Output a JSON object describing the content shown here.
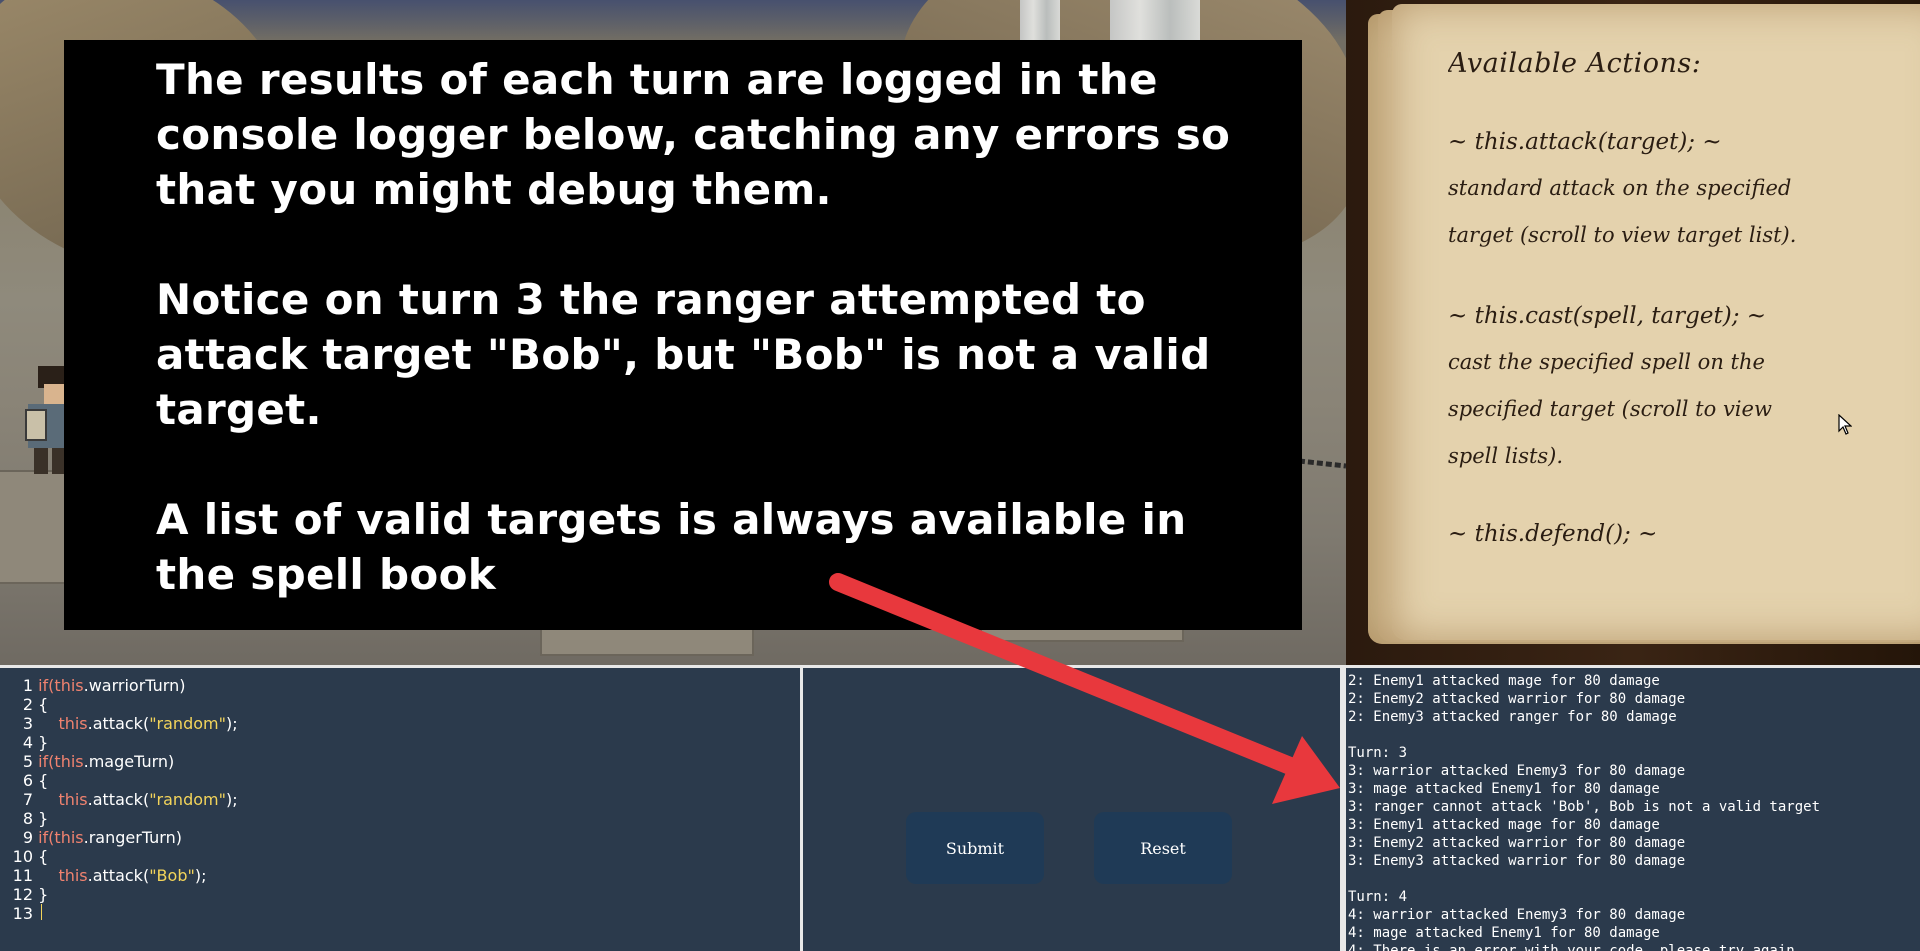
{
  "tutorial": {
    "paragraph1": "The results of each turn are logged in the console logger below, catching any errors so that you might debug them.",
    "paragraph2": "Notice on turn 3 the ranger attempted to attack target \"Bob\", but \"Bob\" is not a valid target.",
    "paragraph3": "A list of valid targets is always available in the spell book"
  },
  "spellbook": {
    "title": "Available Actions:",
    "actions": [
      {
        "signature": "~ this.attack(target); ~",
        "description": "standard attack on the specified target (scroll to view target list)."
      },
      {
        "signature": "~ this.cast(spell, target); ~",
        "description": "cast the specified spell on the specified target (scroll to view spell lists)."
      }
    ],
    "partial_next": "~ this.defend(); ~"
  },
  "editor": {
    "lines": [
      {
        "n": "1",
        "kw": "if(",
        "this": "this",
        "rest": ".warriorTurn)",
        "str": "",
        "tail": ""
      },
      {
        "n": "2",
        "kw": "",
        "this": "",
        "rest": "{",
        "str": "",
        "tail": ""
      },
      {
        "n": "3",
        "kw": "",
        "this": "    this",
        "rest": ".attack(",
        "str": "\"random\"",
        "tail": ");"
      },
      {
        "n": "4",
        "kw": "",
        "this": "",
        "rest": "}",
        "str": "",
        "tail": ""
      },
      {
        "n": "5",
        "kw": "if(",
        "this": "this",
        "rest": ".mageTurn)",
        "str": "",
        "tail": ""
      },
      {
        "n": "6",
        "kw": "",
        "this": "",
        "rest": "{",
        "str": "",
        "tail": ""
      },
      {
        "n": "7",
        "kw": "",
        "this": "    this",
        "rest": ".attack(",
        "str": "\"random\"",
        "tail": ");"
      },
      {
        "n": "8",
        "kw": "",
        "this": "",
        "rest": "}",
        "str": "",
        "tail": ""
      },
      {
        "n": "9",
        "kw": "if(",
        "this": "this",
        "rest": ".rangerTurn)",
        "str": "",
        "tail": ""
      },
      {
        "n": "10",
        "kw": "",
        "this": "",
        "rest": "{",
        "str": "",
        "tail": ""
      },
      {
        "n": "11",
        "kw": "",
        "this": "    this",
        "rest": ".attack(",
        "str": "\"Bob\"",
        "tail": ");"
      },
      {
        "n": "12",
        "kw": "",
        "this": "",
        "rest": "}",
        "str": "",
        "tail": ""
      },
      {
        "n": "13",
        "kw": "",
        "this": "",
        "rest": "",
        "str": "",
        "tail": ""
      }
    ]
  },
  "controls": {
    "submit_label": "Submit",
    "reset_label": "Reset"
  },
  "console": {
    "lines": [
      "2: Enemy1 attacked mage for 80 damage",
      "2: Enemy2 attacked warrior for 80 damage",
      "2: Enemy3 attacked ranger for 80 damage",
      "",
      "Turn: 3",
      "3: warrior attacked Enemy3 for 80 damage",
      "3: mage attacked Enemy1 for 80 damage",
      "3: ranger cannot attack 'Bob', Bob is not a valid target",
      "3: Enemy1 attacked mage for 80 damage",
      "3: Enemy2 attacked warrior for 80 damage",
      "3: Enemy3 attacked warrior for 80 damage",
      "",
      "Turn: 4",
      "4: warrior attacked Enemy3 for 80 damage",
      "4: mage attacked Enemy1 for 80 damage",
      "4: There is an error with your code, please try again"
    ]
  },
  "colors": {
    "panel_bg": "#2b3a4c",
    "keyword": "#f0826f",
    "string": "#f3d45a",
    "button_bg": "#1f3a56",
    "arrow": "#e8383d"
  }
}
